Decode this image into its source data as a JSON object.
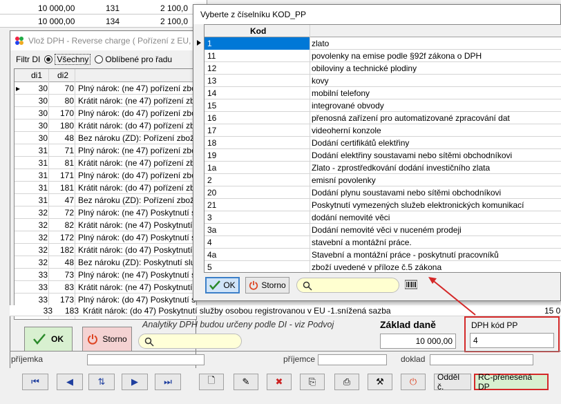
{
  "bg_table": {
    "rows": [
      {
        "a": "10 000,00",
        "b": "131",
        "c": "2 100,0"
      },
      {
        "a": "10 000,00",
        "b": "134",
        "c": "2 100,0"
      }
    ]
  },
  "vloz_window": {
    "title": "Vlož DPH - Reverse charge ( Pořízení z EU, Do",
    "filter_label": "Filtr DI",
    "radio_all": "Všechny",
    "radio_fav": "Oblíbené pro řadu",
    "col_di1": "di1",
    "col_di2": "di2",
    "rows": [
      {
        "d1": "30",
        "d2": "70",
        "t": "Plný nárok: (ne 47) pořízení zbo"
      },
      {
        "d1": "30",
        "d2": "80",
        "t": "Krátit nárok: (ne 47) pořízení zbo"
      },
      {
        "d1": "30",
        "d2": "170",
        "t": "Plný nárok: (do 47) pořízení zbo"
      },
      {
        "d1": "30",
        "d2": "180",
        "t": "Krátit nárok: (do 47) pořízení zbo"
      },
      {
        "d1": "30",
        "d2": "48",
        "t": "Bez nároku (ZD): Pořízení zboží"
      },
      {
        "d1": "31",
        "d2": "71",
        "t": "Plný nárok: (ne 47) pořízení zbo"
      },
      {
        "d1": "31",
        "d2": "81",
        "t": "Krátit nárok: (ne 47) pořízení zbo"
      },
      {
        "d1": "31",
        "d2": "171",
        "t": "Plný nárok: (do 47) pořízení zbo"
      },
      {
        "d1": "31",
        "d2": "181",
        "t": "Krátit nárok: (do 47) pořízení zbo"
      },
      {
        "d1": "31",
        "d2": "47",
        "t": "Bez nároku (ZD): Pořízení zboží"
      },
      {
        "d1": "32",
        "d2": "72",
        "t": "Plný nárok: (ne 47) Poskytnutí s"
      },
      {
        "d1": "32",
        "d2": "82",
        "t": "Krátit nárok: (ne 47) Poskytnutí"
      },
      {
        "d1": "32",
        "d2": "172",
        "t": "Plný nárok: (do 47) Poskytnutí s"
      },
      {
        "d1": "32",
        "d2": "182",
        "t": "Krátit nárok: (do 47) Poskytnutí"
      },
      {
        "d1": "32",
        "d2": "48",
        "t": "Bez nároku (ZD): Poskytnutí služ"
      },
      {
        "d1": "33",
        "d2": "73",
        "t": "Plný nárok: (ne 47) Poskytnutí s"
      },
      {
        "d1": "33",
        "d2": "83",
        "t": "Krátit nárok: (ne 47) Poskytnutí"
      },
      {
        "d1": "33",
        "d2": "173",
        "t": "Plný nárok: (do 47) Poskytnutí s"
      }
    ],
    "row33": {
      "d1": "33",
      "d2": "183",
      "t": "Krátit nárok: (do 47) Poskytnutí služby osobou registrovanou v EU -1.snížená sazba",
      "tail": "15 0"
    },
    "ok": "OK",
    "storno": "Storno",
    "analytics_note": "Analytiky DPH budou určeny podle DI - viz  Podvoj",
    "zaklad_label": "Základ daně",
    "zaklad_value": "10 000,00",
    "dph_kod_label": "DPH kód PP",
    "dph_kod_value": "4"
  },
  "ghost_labels": {
    "a": "příjemka",
    "b": "příjemce",
    "c": "doklad"
  },
  "codelist": {
    "title": "Vyberte z číselníku KOD_PP",
    "col_kod": "Kod",
    "rows": [
      {
        "k": "1",
        "n": "zlato"
      },
      {
        "k": "11",
        "n": "povolenky na emise podle §92f zákona o DPH"
      },
      {
        "k": "12",
        "n": "obiloviny a technické plodiny"
      },
      {
        "k": "13",
        "n": "kovy"
      },
      {
        "k": "14",
        "n": "mobilní telefony"
      },
      {
        "k": "15",
        "n": "integrované obvody"
      },
      {
        "k": "16",
        "n": "přenosná zařízení pro automatizované zpracování dat"
      },
      {
        "k": "17",
        "n": "videoherní konzole"
      },
      {
        "k": "18",
        "n": "Dodání certifikátů elektřiny"
      },
      {
        "k": "19",
        "n": "Dodání elektřiny soustavami nebo sítěmi obchodníkovi"
      },
      {
        "k": "1a",
        "n": "Zlato - zprostředkování dodání investičního zlata"
      },
      {
        "k": "2",
        "n": "emisní povolenky"
      },
      {
        "k": "20",
        "n": "Dodání plynu soustavami nebo sítěmi obchodníkovi"
      },
      {
        "k": "21",
        "n": "Poskytnutí vymezených služeb elektronických komunikací"
      },
      {
        "k": "3",
        "n": "dodání nemovité věci"
      },
      {
        "k": "3a",
        "n": "Dodání nemovité věci v nuceném prodeji"
      },
      {
        "k": "4",
        "n": "stavební a montážní práce."
      },
      {
        "k": "4a",
        "n": "Stavební a montážní práce - poskytnutí pracovníků"
      },
      {
        "k": "5",
        "n": "zboží uvedené v příloze č.5 zákona"
      }
    ],
    "ok": "OK",
    "storno": "Storno"
  },
  "toolbar": {
    "odde_label": "Odděl č.",
    "rc_label": "RC-přenesená DP"
  },
  "colors": {
    "selection": "#0078d7",
    "highlight_red": "#d42828",
    "ok_green": "#d8f0d0",
    "storno_red": "#f4d2d2",
    "search_yellow": "#ffffd0"
  }
}
